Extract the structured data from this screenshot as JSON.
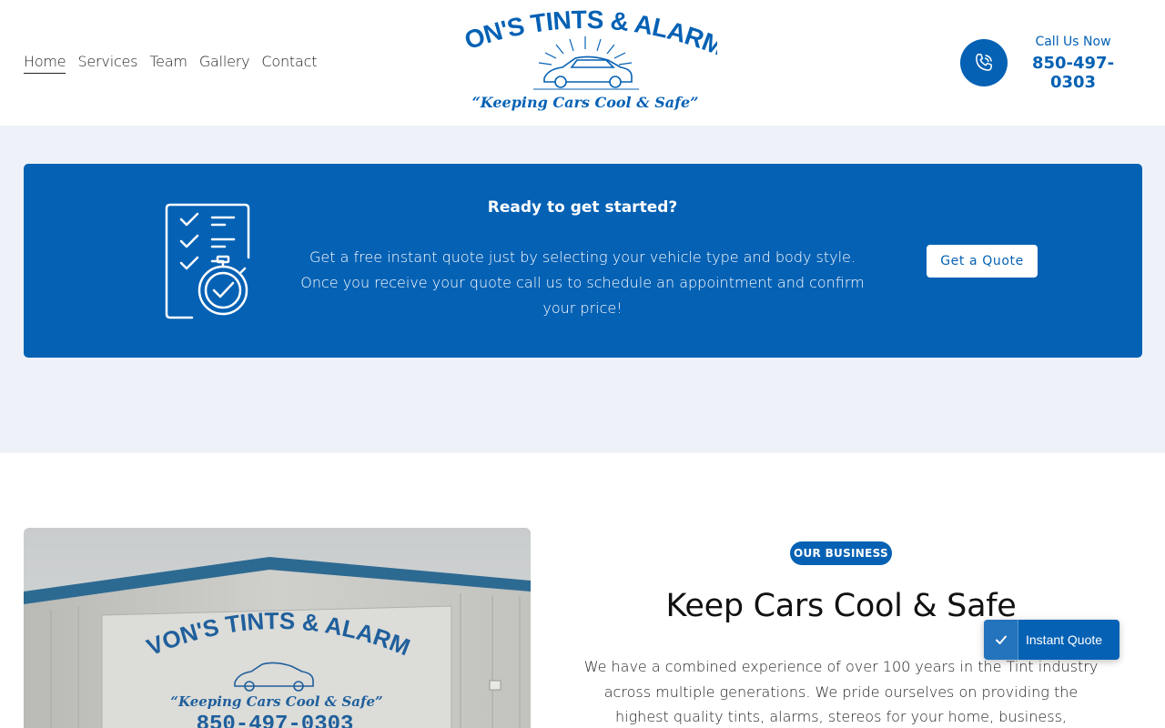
{
  "colors": {
    "brand": "#0561b4",
    "band": "#eef2f8",
    "white": "#ffffff"
  },
  "nav": {
    "items": [
      {
        "label": "Home",
        "active": true
      },
      {
        "label": "Services",
        "active": false
      },
      {
        "label": "Team",
        "active": false
      },
      {
        "label": "Gallery",
        "active": false
      },
      {
        "label": "Contact",
        "active": false
      }
    ]
  },
  "logo": {
    "title": "EVON'S TINTS & ALARMS",
    "tagline": "“Keeping Cars Cool & Safe”"
  },
  "call": {
    "icon": "phone-icon",
    "label": "Call Us Now",
    "number": "850-497-0303"
  },
  "cta": {
    "icon": "checklist-stopwatch-icon",
    "title": "Ready to get started?",
    "body": "Get a free instant quote just by selecting your vehicle type and body style.   Once you receive your quote  call us to schedule an appointment and confirm your price!",
    "button": "Get a Quote"
  },
  "business": {
    "photo": {
      "sign_title": "EVON'S TINTS & ALARMS",
      "sign_tagline": "“Keeping Cars Cool & Safe”",
      "sign_number": "850-497-0303"
    },
    "badge": "OUR BUSINESS",
    "title": "Keep Cars Cool & Safe",
    "body": "We have a combined experience of over 100 years in the Tint industry across multiple generations.  We pride ourselves on providing the highest quality tints, alarms, stereos for your home, business, automobiles and"
  },
  "instant_quote": {
    "icon": "check-icon",
    "label": "Instant Quote"
  }
}
